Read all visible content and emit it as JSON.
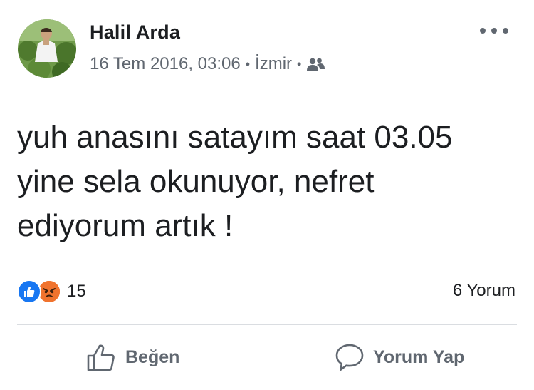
{
  "post": {
    "author": "Halil Arda",
    "timestamp": "16 Tem 2016, 03:06",
    "location": "İzmir",
    "audience_icon": "friends-icon",
    "body_lines": [
      "yuh anasını satayım saat 03.05",
      "yine sela okunuyor, nefret",
      "ediyorum artık !"
    ]
  },
  "reactions": {
    "types": [
      "like",
      "angry"
    ],
    "count": "15"
  },
  "comments": {
    "label": "6 Yorum"
  },
  "actions": {
    "like_label": "Beğen",
    "comment_label": "Yorum Yap"
  },
  "colors": {
    "like_blue": "#1877f2",
    "angry_orange": "#f0732e",
    "text": "#1c1e21",
    "secondary_text": "#606770"
  }
}
